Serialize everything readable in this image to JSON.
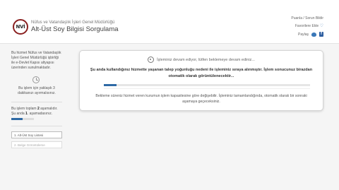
{
  "header": {
    "logo_text": "NVİ",
    "org_name": "Nüfus ve Vatandaşlık İşleri Genel Müdürlüğü",
    "service_title": "Alt-Üst Soy Bilgisi Sorgulama",
    "links": {
      "feedback": "Puanla / Sorun Bildir",
      "favorites": "Favorilere Ekle",
      "share": "Paylaş"
    },
    "icons": [
      "nvi-logo-icon",
      "heart-icon",
      "twitter-icon",
      "facebook-icon"
    ]
  },
  "sidebar": {
    "info": "Bu hizmet Nüfus ve Vatandaşlık İşleri Genel Müdürlüğü işbirliği ile e-Devlet Kapısı altyapısı üzerinden sunulmaktadır.",
    "wait_time": "Bu işlem için yaklaşık 3 dakikanızı ayırmalısınız.",
    "steps_total_prefix": "Bu işlem toplam ",
    "steps_total_value": "2",
    "steps_total_suffix": " aşamalıdır.",
    "steps_current_prefix": "Şu anda ",
    "steps_current_value": "1",
    "steps_current_suffix": ". aşamadasınız.",
    "step_progress": 0.5,
    "steps": [
      {
        "label": "1. Alt-Üst Soy Listesi",
        "active": true
      },
      {
        "label": "2. Belge Görüntüleme",
        "active": false
      }
    ]
  },
  "status_panel": {
    "busy_text": "İşleminiz devam ediyor, lütfen beklemeye devam ediniz...",
    "heavy_load": "Şu anda kullandığınız hizmette yaşanan talep yoğunluğu nedeni ile işleminiz sıraya alınmıştır. İşlem sonucunuz birazdan otomatik olarak görüntülenecektir...",
    "progress": 0.06,
    "note": "Bekleme süreniz hizmet veren kurumun işlem kapasitesine göre değişebilir. İşleminiz tamamlandığında, otomatik olarak bir sonraki aşamaya geçeceksiniz."
  },
  "colors": {
    "accent": "#2f6aa5",
    "logo_ring": "#8a2020",
    "background": "#f5f5f5"
  }
}
